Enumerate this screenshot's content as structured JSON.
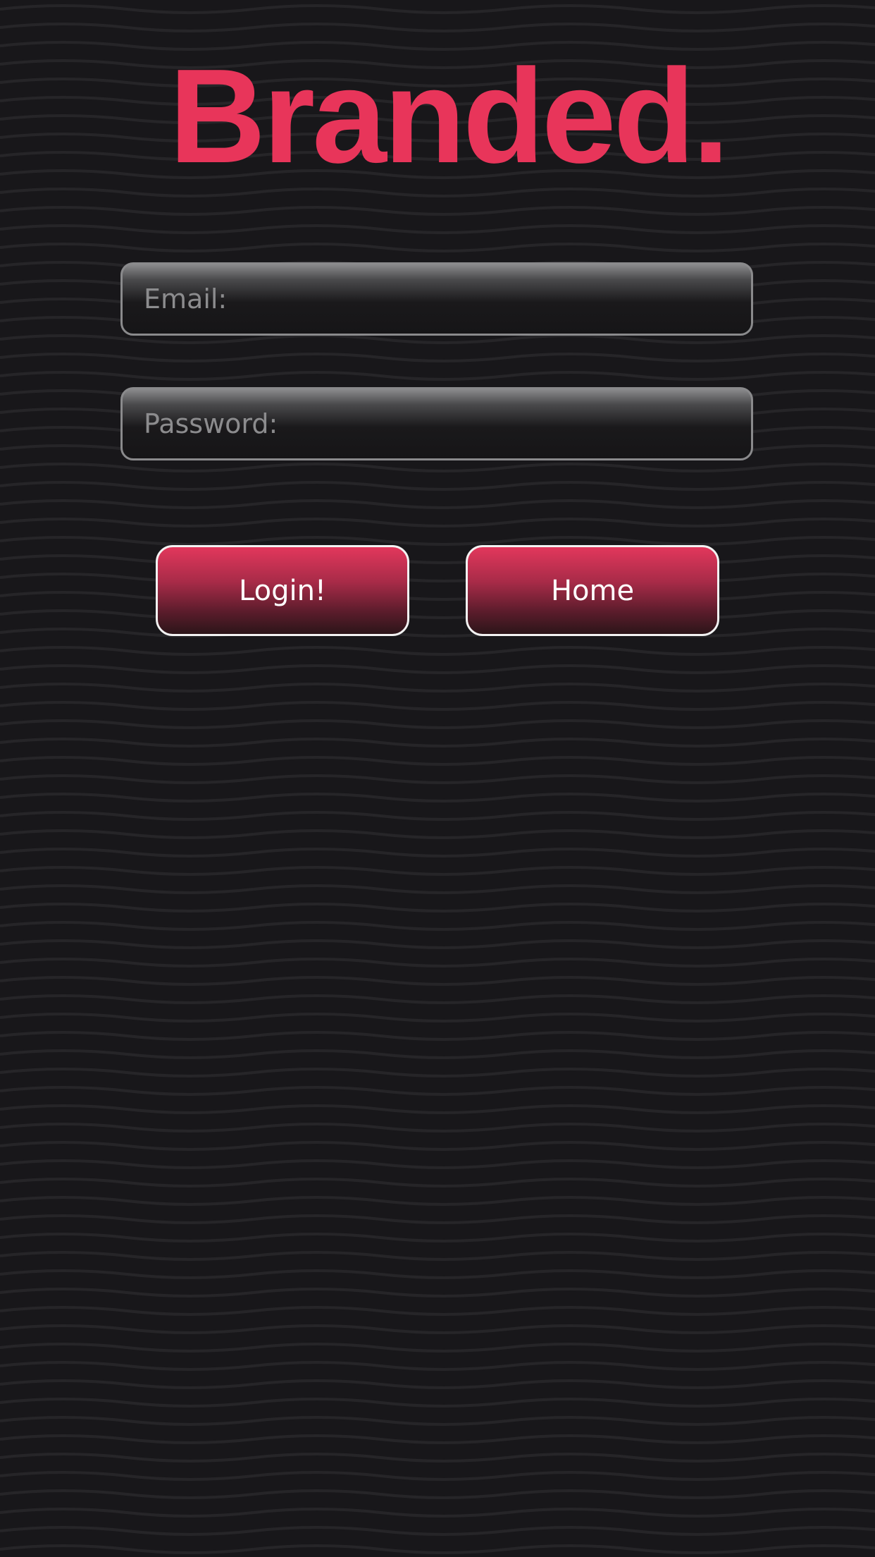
{
  "brand": {
    "logo_text": "Branded.",
    "accent_color": "#e8355a"
  },
  "form": {
    "email_placeholder": "Email:",
    "password_placeholder": "Password:",
    "login_label": "Login!",
    "home_label": "Home"
  },
  "theme": {
    "background": "#18171a",
    "wave_line": "#252427"
  }
}
